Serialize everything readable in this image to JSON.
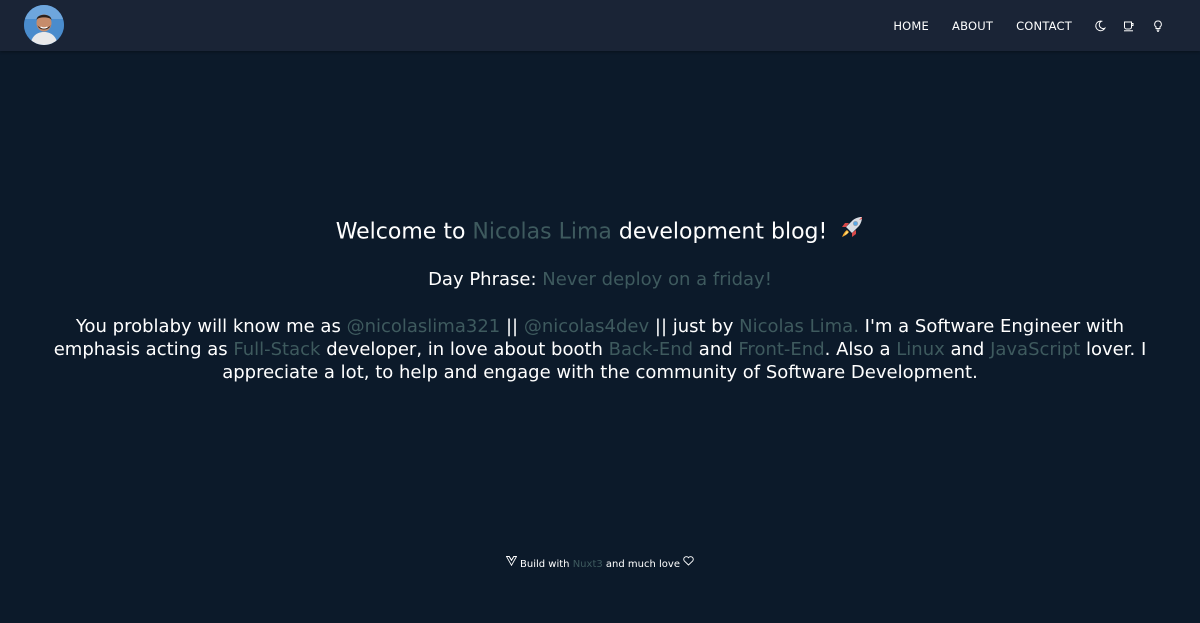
{
  "navbar": {
    "avatar_icon": "avatar-photo",
    "links": [
      "HOME",
      "ABOUT",
      "CONTACT"
    ],
    "icons": [
      "moon-icon",
      "coffee-icon",
      "lightbulb-icon"
    ]
  },
  "welcome": {
    "prefix": "Welcome to ",
    "name": "Nicolas Lima",
    "suffix": " development blog!",
    "emoji_icon": "rocket-icon"
  },
  "phrase": {
    "label": "Day Phrase: ",
    "text": "Never deploy on a friday!"
  },
  "bio": {
    "t1": "You problaby will know me as ",
    "handle1": "@nicolaslima321",
    "t2": " || ",
    "handle2": "@nicolas4dev",
    "t3": " || just by ",
    "name": "Nicolas Lima.",
    "t4": " I'm a Software Engineer with emphasis acting as ",
    "fullstack": "Full-Stack",
    "t5": " developer, in love about booth ",
    "backend": "Back-End",
    "t6": " and ",
    "frontend": "Front-End",
    "t7": ". Also a ",
    "linux": "Linux",
    "t8": " and ",
    "javascript": "JavaScript",
    "t9": " lover. I appreciate a lot, to help and engage with the community of Software Development."
  },
  "footer": {
    "prefix": " Build with ",
    "link": "Nuxt3",
    "suffix": " and much love "
  },
  "colors": {
    "background": "#0c1a2a",
    "navbar": "#1a2436",
    "highlight": "#3e5a5e",
    "text": "#ffffff"
  }
}
